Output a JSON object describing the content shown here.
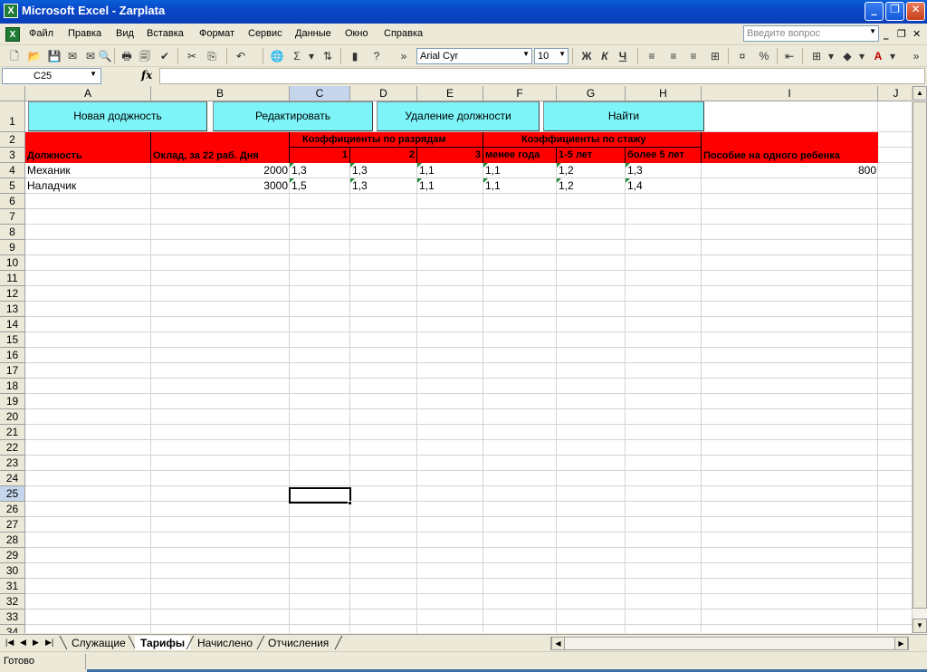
{
  "window": {
    "title": "Microsoft Excel - Zarplata"
  },
  "menu": [
    "Файл",
    "Правка",
    "Вид",
    "Вставка",
    "Формат",
    "Сервис",
    "Данные",
    "Окно",
    "Справка"
  ],
  "help_placeholder": "Введите вопрос",
  "toolbar": {
    "font": "Arial Cyr",
    "size": "10",
    "bold": "Ж",
    "italic": "К",
    "underline": "Ч"
  },
  "formula": {
    "name_box": "C25",
    "fx": "fx",
    "value": ""
  },
  "columns": [
    "A",
    "B",
    "C",
    "D",
    "E",
    "F",
    "G",
    "H",
    "I",
    "J"
  ],
  "active_column": "C",
  "rows": [
    "1",
    "2",
    "3",
    "4",
    "5",
    "6",
    "7",
    "8",
    "9",
    "10",
    "11",
    "12",
    "13",
    "14",
    "15",
    "16",
    "17",
    "18",
    "19",
    "20",
    "21",
    "22",
    "23",
    "24",
    "25",
    "26",
    "27",
    "28",
    "29",
    "30",
    "31",
    "32",
    "33",
    "34"
  ],
  "active_row": "25",
  "buttons": {
    "new_position": "Новая доджность",
    "edit": "Редактировать",
    "delete_position": "Удаление должности",
    "find": "Найти"
  },
  "table_header": {
    "position": "Должность",
    "salary": "Оклад, за 22 раб. Дня",
    "grade_coef": "Коэффициенты по разрядам",
    "grade_1": "1",
    "grade_2": "2",
    "grade_3": "3",
    "tenure_coef": "Коэффициенты по стажу",
    "tenure_lt1": "менее года",
    "tenure_1_5": "1-5 лет",
    "tenure_gt5": "более 5 лет",
    "child_benefit": "Пособие на одного ребенка"
  },
  "table_rows": [
    {
      "position": "Механик",
      "salary": "2000",
      "g1": "1,3",
      "g2": "1,3",
      "g3": "1,1",
      "t1": "1,1",
      "t2": "1,2",
      "t3": "1,3",
      "benefit": "800"
    },
    {
      "position": "Наладчик",
      "salary": "3000",
      "g1": "1,5",
      "g2": "1,3",
      "g3": "1,1",
      "t1": "1,1",
      "t2": "1,2",
      "t3": "1,4",
      "benefit": ""
    }
  ],
  "sheets": [
    "Служащие",
    "Тарифы",
    "Начислено",
    "Отчисления"
  ],
  "active_sheet": "Тарифы",
  "status": "Готово",
  "colors": {
    "header_fill": "#FF0000",
    "button_fill": "#7DF5F8",
    "title_bar": "#0A5FD8"
  }
}
